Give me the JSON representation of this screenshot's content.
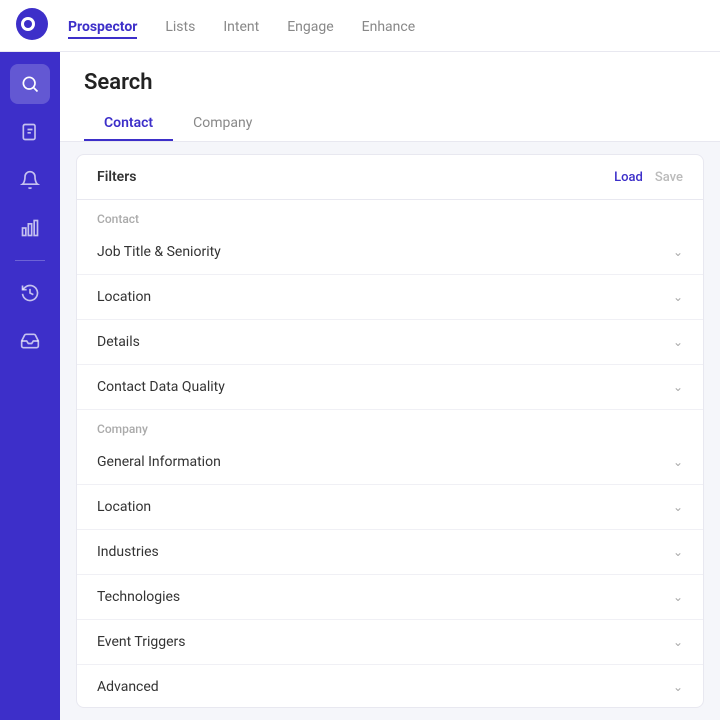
{
  "topNav": {
    "links": [
      {
        "label": "Prospector",
        "active": true
      },
      {
        "label": "Lists",
        "active": false
      },
      {
        "label": "Intent",
        "active": false
      },
      {
        "label": "Engage",
        "active": false
      },
      {
        "label": "Enhance",
        "active": false
      }
    ]
  },
  "sidebar": {
    "icons": [
      {
        "name": "search-icon",
        "active": true
      },
      {
        "name": "contact-book-icon",
        "active": false
      },
      {
        "name": "bell-icon",
        "active": false
      },
      {
        "name": "chart-icon",
        "active": false
      },
      {
        "name": "history-icon",
        "active": false
      },
      {
        "name": "inbox-icon",
        "active": false
      }
    ]
  },
  "pageTitle": "Search",
  "tabs": [
    {
      "label": "Contact",
      "active": true
    },
    {
      "label": "Company",
      "active": false
    }
  ],
  "filtersHeader": {
    "label": "Filters",
    "loadLabel": "Load",
    "saveLabel": "Save"
  },
  "contactSection": {
    "sectionLabel": "Contact",
    "items": [
      {
        "label": "Job Title & Seniority"
      },
      {
        "label": "Location"
      },
      {
        "label": "Details"
      },
      {
        "label": "Contact Data Quality"
      }
    ]
  },
  "companySection": {
    "sectionLabel": "Company",
    "items": [
      {
        "label": "General Information"
      },
      {
        "label": "Location"
      },
      {
        "label": "Industries"
      },
      {
        "label": "Technologies"
      },
      {
        "label": "Event Triggers"
      },
      {
        "label": "Advanced"
      }
    ]
  }
}
